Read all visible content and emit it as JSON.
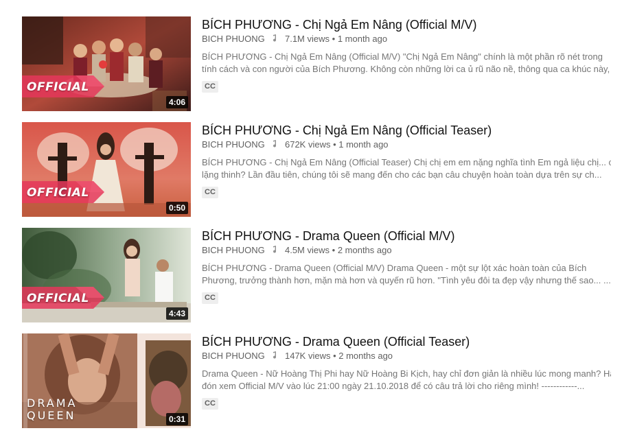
{
  "videos": [
    {
      "title": "BÍCH PHƯƠNG - Chị Ngả Em Nâng (Official M/V)",
      "channel": "BICH PHUONG",
      "views": "7.1M views",
      "age": "1 month ago",
      "desc_line1": "BÍCH PHƯƠNG - Chị Ngả Em Nâng (Official M/V) \"Chị Ngả Em Nâng\" chính là một phần rõ nét trong",
      "desc_line2": "tính cách và con người của Bích Phương. Không còn những lời ca ủ rũ não nề, thông qua ca khúc này,",
      "badge": "CC",
      "duration": "4:06",
      "thumb_label": "OFFICIAL"
    },
    {
      "title": "BÍCH PHƯƠNG - Chị Ngả Em Nâng (Official Teaser)",
      "channel": "BICH PHUONG",
      "views": "672K views",
      "age": "1 month ago",
      "desc_line1": "BÍCH PHƯƠNG - Chị Ngả Em Nâng (Official Teaser) Chị chị em em nặng nghĩa tình Em ngả liệu chị... có",
      "desc_line2": "lặng thinh? Lần đầu tiên, chúng tôi sẽ mang đến cho các bạn câu chuyện hoàn toàn dựa trên sự ch...",
      "badge": "CC",
      "duration": "0:50",
      "thumb_label": "OFFICIAL"
    },
    {
      "title": "BÍCH PHƯƠNG - Drama Queen (Official M/V)",
      "channel": "BICH PHUONG",
      "views": "4.5M views",
      "age": "2 months ago",
      "desc_line1": "BÍCH PHƯƠNG - Drama Queen (Official M/V) Drama Queen - một sự lột xác hoàn toàn của Bích",
      "desc_line2": "Phương, trưởng thành hơn, mặn mà hơn và quyến rũ hơn. \"Tình yêu đôi ta đẹp vậy nhưng thế sao... ...",
      "badge": "CC",
      "duration": "4:43",
      "thumb_label": "OFFICIAL"
    },
    {
      "title": "BÍCH PHƯƠNG - Drama Queen (Official Teaser)",
      "channel": "BICH PHUONG",
      "views": "147K views",
      "age": "2 months ago",
      "desc_line1": "Drama Queen - Nữ Hoàng Thị Phi hay Nữ Hoàng Bi Kịch, hay chỉ đơn giản là nhiều lúc mong manh? Hãy",
      "desc_line2": "đón xem Official M/V vào lúc 21:00 ngày 21.10.2018 để có câu trả lời cho riêng mình! ------------...",
      "badge": "CC",
      "duration": "0:31",
      "thumb_label_line1": "DRAMA",
      "thumb_label_line2": "QUEEN"
    }
  ],
  "colors": {
    "title": "#111111",
    "meta": "#606060",
    "desc": "#757575",
    "official_tag": "#e5375a"
  }
}
